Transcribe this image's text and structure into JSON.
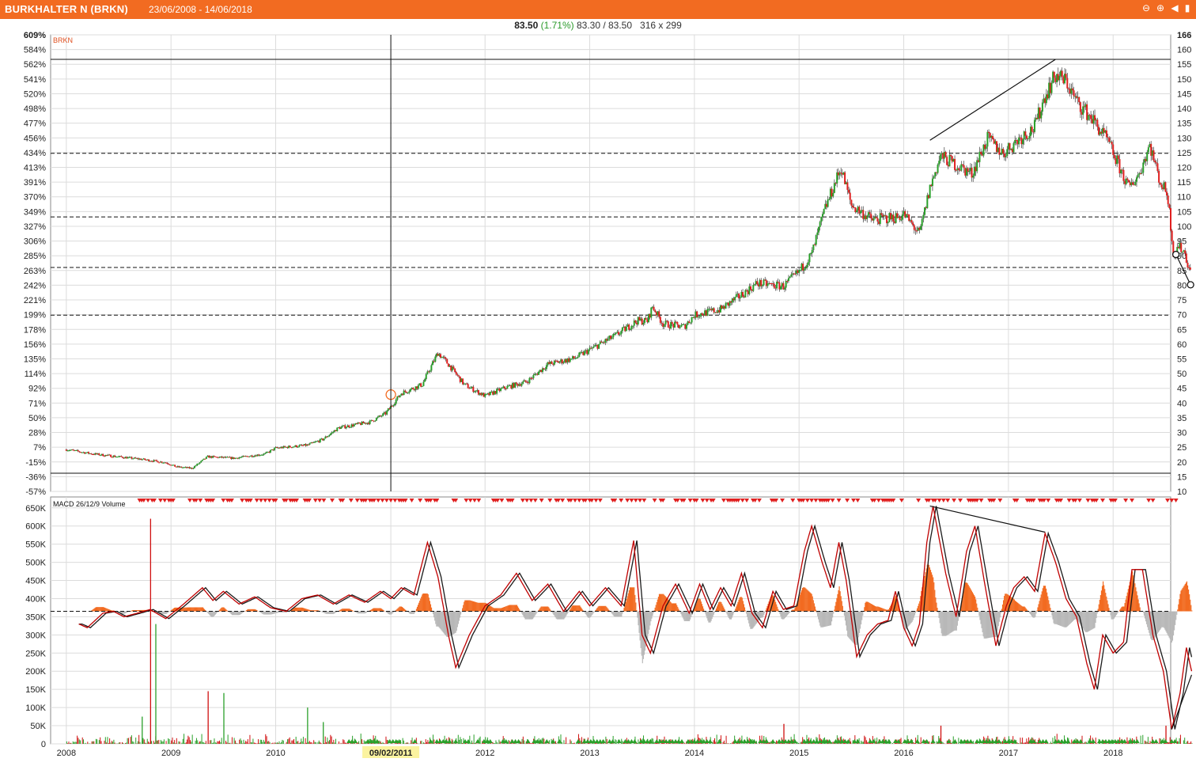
{
  "window": {
    "title": "BURKHALTER N (BRKN)",
    "date_range": "23/06/2008 - 14/06/2018",
    "controls": [
      "minus-icon",
      "plus-icon",
      "play-left-icon",
      "pin-icon"
    ]
  },
  "quote": {
    "last": "83.50",
    "change": "(1.71%)",
    "bid_ask": "83.30 / 83.50",
    "size": "316 x 299"
  },
  "colors": {
    "title_bar": "#f26b21",
    "up_candle": "#2aa02a",
    "down_candle": "#e02020",
    "macd_line": "#c00000",
    "signal_line": "#1a1a1a",
    "hist_pos": "#f26b21",
    "hist_neg": "#b8b8b8",
    "vol_up": "#2aa02a",
    "vol_down": "#d01010"
  },
  "chart_data": [
    {
      "type": "candlestick",
      "series_label": "BRKN",
      "y_left_ticks": [
        "609%",
        "584%",
        "562%",
        "541%",
        "520%",
        "498%",
        "477%",
        "456%",
        "434%",
        "413%",
        "391%",
        "370%",
        "349%",
        "327%",
        "306%",
        "285%",
        "263%",
        "242%",
        "221%",
        "199%",
        "178%",
        "156%",
        "135%",
        "114%",
        "92%",
        "71%",
        "50%",
        "28%",
        "7%",
        "-15%",
        "-36%",
        "-57%"
      ],
      "y_right_ticks": [
        "166",
        "160",
        "155",
        "150",
        "145",
        "140",
        "135",
        "130",
        "125",
        "120",
        "115",
        "110",
        "105",
        "100",
        "95",
        "90",
        "85",
        "80",
        "75",
        "70",
        "65",
        "60",
        "55",
        "50",
        "45",
        "40",
        "35",
        "30",
        "25",
        "20",
        "15",
        "10"
      ],
      "ylim": [
        8,
        166
      ],
      "x_ticks": [
        {
          "label": "2008",
          "t": 2008.0
        },
        {
          "label": "2009",
          "t": 2009.0
        },
        {
          "label": "2010",
          "t": 2010.0
        },
        {
          "label": "09/02/2011",
          "t": 2011.1,
          "highlight": true
        },
        {
          "label": "2012",
          "t": 2012.0
        },
        {
          "label": "2013",
          "t": 2013.0
        },
        {
          "label": "2014",
          "t": 2014.0
        },
        {
          "label": "2015",
          "t": 2015.0
        },
        {
          "label": "2016",
          "t": 2016.0
        },
        {
          "label": "2017",
          "t": 2017.0
        },
        {
          "label": "2018",
          "t": 2018.0
        }
      ],
      "xlim": [
        2007.85,
        2018.55
      ],
      "cursor_t": 2011.1,
      "price_path": [
        [
          2008.0,
          22.5
        ],
        [
          2008.25,
          21.0
        ],
        [
          2008.5,
          20.0
        ],
        [
          2008.75,
          19.0
        ],
        [
          2008.95,
          18.0
        ],
        [
          2009.05,
          16.5
        ],
        [
          2009.2,
          16.0
        ],
        [
          2009.35,
          20.0
        ],
        [
          2009.6,
          19.5
        ],
        [
          2009.9,
          21.0
        ],
        [
          2010.0,
          23.0
        ],
        [
          2010.3,
          24.0
        ],
        [
          2010.45,
          26.0
        ],
        [
          2010.6,
          30.0
        ],
        [
          2010.9,
          32.0
        ],
        [
          2011.05,
          35.0
        ],
        [
          2011.2,
          42.0
        ],
        [
          2011.4,
          45.0
        ],
        [
          2011.55,
          56.0
        ],
        [
          2011.65,
          52.0
        ],
        [
          2011.8,
          45.0
        ],
        [
          2012.0,
          41.0
        ],
        [
          2012.2,
          44.0
        ],
        [
          2012.4,
          46.0
        ],
        [
          2012.6,
          52.0
        ],
        [
          2012.85,
          54.0
        ],
        [
          2013.0,
          57.0
        ],
        [
          2013.25,
          62.0
        ],
        [
          2013.45,
          67.0
        ],
        [
          2013.55,
          67.0
        ],
        [
          2013.6,
          72.0
        ],
        [
          2013.7,
          66.0
        ],
        [
          2013.9,
          65.0
        ],
        [
          2014.0,
          69.0
        ],
        [
          2014.25,
          71.0
        ],
        [
          2014.45,
          76.0
        ],
        [
          2014.6,
          80.0
        ],
        [
          2014.85,
          79.0
        ],
        [
          2015.0,
          84.0
        ],
        [
          2015.12,
          90.0
        ],
        [
          2015.25,
          106.0
        ],
        [
          2015.4,
          120.0
        ],
        [
          2015.5,
          107.0
        ],
        [
          2015.7,
          102.0
        ],
        [
          2015.95,
          103.0
        ],
        [
          2016.0,
          104.0
        ],
        [
          2016.15,
          97.0
        ],
        [
          2016.25,
          113.0
        ],
        [
          2016.35,
          124.0
        ],
        [
          2016.5,
          121.0
        ],
        [
          2016.65,
          118.0
        ],
        [
          2016.8,
          130.0
        ],
        [
          2016.95,
          125.0
        ],
        [
          2017.1,
          130.0
        ],
        [
          2017.25,
          134.0
        ],
        [
          2017.35,
          145.0
        ],
        [
          2017.45,
          152.0
        ],
        [
          2017.55,
          150.0
        ],
        [
          2017.65,
          143.0
        ],
        [
          2017.8,
          137.0
        ],
        [
          2017.95,
          129.0
        ],
        [
          2018.05,
          121.0
        ],
        [
          2018.15,
          113.0
        ],
        [
          2018.25,
          118.0
        ],
        [
          2018.35,
          128.0
        ],
        [
          2018.45,
          115.0
        ],
        [
          2018.52,
          111.0
        ],
        [
          2018.58,
          89.0
        ],
        [
          2018.62,
          93.0
        ],
        [
          2018.68,
          91.0
        ],
        [
          2018.72,
          86.0
        ],
        [
          2018.74,
          83.5
        ]
      ],
      "horizontal_lines": [
        {
          "value": 157.5,
          "style": "solid"
        },
        {
          "value": 125.0,
          "style": "dashed"
        },
        {
          "value": 103.0,
          "style": "dashed"
        },
        {
          "value": 85.5,
          "style": "dashed"
        },
        {
          "value": 69.0,
          "style": "dashed"
        },
        {
          "value": 14.3,
          "style": "solid"
        }
      ],
      "trendlines": [
        {
          "from": [
            2016.25,
            129.5
          ],
          "to": [
            2017.45,
            157.5
          ]
        },
        {
          "from": [
            2018.6,
            90.0
          ],
          "to": [
            2018.74,
            79.5
          ]
        }
      ],
      "markers": [
        {
          "kind": "orange-ring",
          "t": 2011.1,
          "value": 41.5
        },
        {
          "kind": "ring",
          "t": 2018.6,
          "value": 90.0
        },
        {
          "kind": "ring",
          "t": 2018.74,
          "value": 79.5
        }
      ]
    },
    {
      "type": "line",
      "title": "MACD 26/12/9 Volume",
      "y_ticks": [
        "650K",
        "600K",
        "550K",
        "500K",
        "450K",
        "400K",
        "350K",
        "300K",
        "250K",
        "200K",
        "150K",
        "100K",
        "50K",
        "0"
      ],
      "ylim": [
        0,
        680000
      ],
      "reference_line": 365000,
      "macd_path": [
        [
          2008.12,
          330000
        ],
        [
          2008.2,
          320000
        ],
        [
          2008.35,
          360000
        ],
        [
          2008.45,
          365000
        ],
        [
          2008.55,
          350000
        ],
        [
          2008.68,
          360000
        ],
        [
          2008.8,
          370000
        ],
        [
          2008.95,
          345000
        ],
        [
          2009.1,
          380000
        ],
        [
          2009.3,
          430000
        ],
        [
          2009.4,
          395000
        ],
        [
          2009.5,
          420000
        ],
        [
          2009.65,
          385000
        ],
        [
          2009.8,
          405000
        ],
        [
          2009.95,
          375000
        ],
        [
          2010.1,
          365000
        ],
        [
          2010.25,
          400000
        ],
        [
          2010.4,
          410000
        ],
        [
          2010.55,
          385000
        ],
        [
          2010.7,
          410000
        ],
        [
          2010.85,
          390000
        ],
        [
          2011.0,
          420000
        ],
        [
          2011.1,
          400000
        ],
        [
          2011.2,
          430000
        ],
        [
          2011.32,
          410000
        ],
        [
          2011.45,
          555000
        ],
        [
          2011.55,
          460000
        ],
        [
          2011.65,
          300000
        ],
        [
          2011.72,
          210000
        ],
        [
          2011.85,
          300000
        ],
        [
          2012.0,
          380000
        ],
        [
          2012.15,
          410000
        ],
        [
          2012.3,
          470000
        ],
        [
          2012.45,
          395000
        ],
        [
          2012.6,
          440000
        ],
        [
          2012.75,
          365000
        ],
        [
          2012.9,
          420000
        ],
        [
          2013.0,
          380000
        ],
        [
          2013.15,
          430000
        ],
        [
          2013.3,
          380000
        ],
        [
          2013.42,
          560000
        ],
        [
          2013.5,
          300000
        ],
        [
          2013.58,
          250000
        ],
        [
          2013.7,
          380000
        ],
        [
          2013.82,
          440000
        ],
        [
          2013.95,
          360000
        ],
        [
          2014.05,
          440000
        ],
        [
          2014.15,
          370000
        ],
        [
          2014.25,
          430000
        ],
        [
          2014.35,
          380000
        ],
        [
          2014.45,
          470000
        ],
        [
          2014.55,
          360000
        ],
        [
          2014.65,
          320000
        ],
        [
          2014.75,
          420000
        ],
        [
          2014.85,
          370000
        ],
        [
          2014.95,
          380000
        ],
        [
          2015.05,
          530000
        ],
        [
          2015.12,
          600000
        ],
        [
          2015.22,
          500000
        ],
        [
          2015.3,
          430000
        ],
        [
          2015.38,
          555000
        ],
        [
          2015.45,
          450000
        ],
        [
          2015.55,
          240000
        ],
        [
          2015.65,
          300000
        ],
        [
          2015.75,
          330000
        ],
        [
          2015.85,
          340000
        ],
        [
          2015.92,
          420000
        ],
        [
          2016.0,
          320000
        ],
        [
          2016.08,
          270000
        ],
        [
          2016.15,
          330000
        ],
        [
          2016.22,
          555000
        ],
        [
          2016.28,
          655000
        ],
        [
          2016.4,
          470000
        ],
        [
          2016.5,
          350000
        ],
        [
          2016.6,
          530000
        ],
        [
          2016.68,
          600000
        ],
        [
          2016.78,
          430000
        ],
        [
          2016.88,
          270000
        ],
        [
          2016.98,
          380000
        ],
        [
          2017.05,
          430000
        ],
        [
          2017.15,
          460000
        ],
        [
          2017.25,
          420000
        ],
        [
          2017.35,
          580000
        ],
        [
          2017.45,
          500000
        ],
        [
          2017.55,
          400000
        ],
        [
          2017.65,
          350000
        ],
        [
          2017.75,
          220000
        ],
        [
          2017.82,
          150000
        ],
        [
          2017.9,
          300000
        ],
        [
          2018.0,
          250000
        ],
        [
          2018.1,
          280000
        ],
        [
          2018.18,
          480000
        ],
        [
          2018.28,
          480000
        ],
        [
          2018.38,
          300000
        ],
        [
          2018.48,
          200000
        ],
        [
          2018.56,
          40000
        ],
        [
          2018.64,
          140000
        ],
        [
          2018.7,
          265000
        ],
        [
          2018.75,
          200000
        ]
      ],
      "trendlines": [
        {
          "from": [
            2016.25,
            655000
          ],
          "to": [
            2017.35,
            583000
          ]
        },
        {
          "from": [
            2018.56,
            40000
          ],
          "to": [
            2018.75,
            190000
          ]
        }
      ],
      "volume_spikes": [
        {
          "t": 2008.8,
          "value": 620000,
          "dir": "down"
        },
        {
          "t": 2008.85,
          "value": 330000,
          "dir": "up"
        },
        {
          "t": 2008.72,
          "value": 75000,
          "dir": "up"
        },
        {
          "t": 2009.35,
          "value": 145000,
          "dir": "down"
        },
        {
          "t": 2009.5,
          "value": 140000,
          "dir": "up"
        },
        {
          "t": 2010.3,
          "value": 100000,
          "dir": "up"
        },
        {
          "t": 2010.45,
          "value": 60000,
          "dir": "up"
        },
        {
          "t": 2014.85,
          "value": 55000,
          "dir": "down"
        },
        {
          "t": 2016.35,
          "value": 50000,
          "dir": "down"
        },
        {
          "t": 2018.5,
          "value": 50000,
          "dir": "down"
        }
      ]
    }
  ]
}
